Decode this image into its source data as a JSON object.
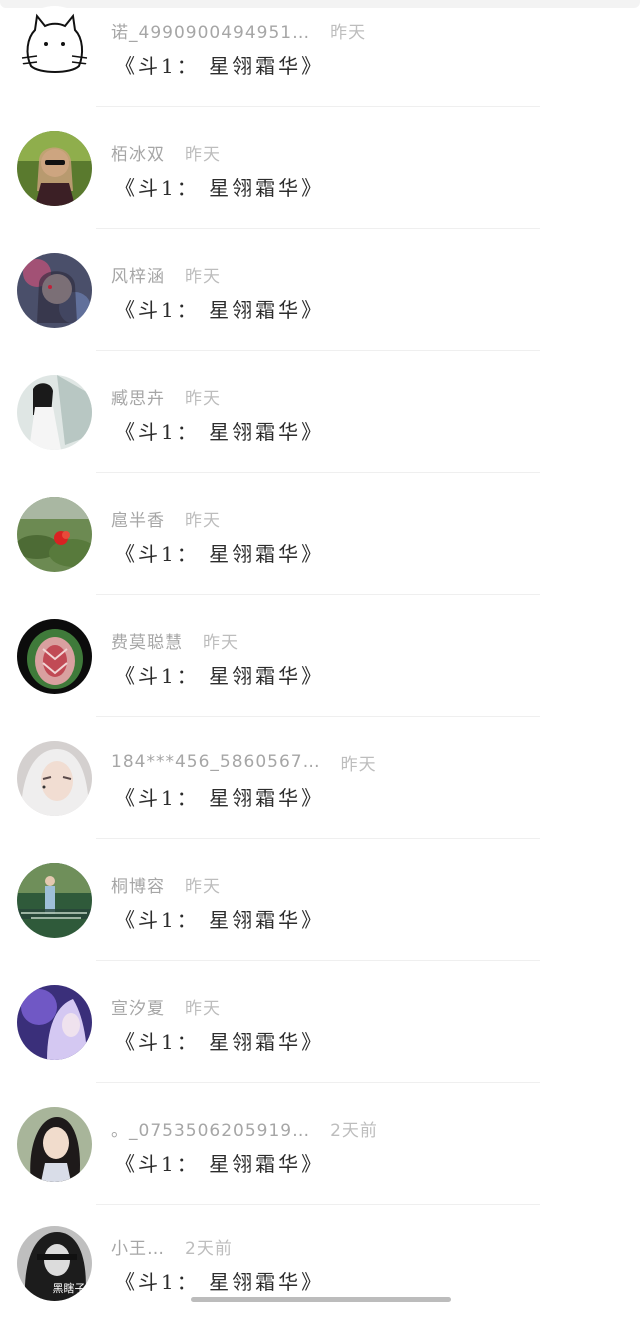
{
  "items": [
    {
      "name": "诺_4990900494951…",
      "time": "昨天",
      "title": "《斗1： 星翎霜华》",
      "avatar": "cat-sketch-avatar"
    },
    {
      "name": "栢冰双",
      "time": "昨天",
      "title": "《斗1： 星翎霜华》",
      "avatar": "girl-sunglasses-avatar"
    },
    {
      "name": "风梓涵",
      "time": "昨天",
      "title": "《斗1： 星翎霜华》",
      "avatar": "fantasy-girl-avatar"
    },
    {
      "name": "臧思卉",
      "time": "昨天",
      "title": "《斗1： 星翎霜华》",
      "avatar": "white-robe-man-avatar"
    },
    {
      "name": "扈半香",
      "time": "昨天",
      "title": "《斗1： 星翎霜华》",
      "avatar": "mossy-landscape-avatar"
    },
    {
      "name": "费莫聪慧",
      "time": "昨天",
      "title": "《斗1： 星翎霜华》",
      "avatar": "carved-fruit-avatar"
    },
    {
      "name": "184***456_5860567…",
      "time": "昨天",
      "title": "《斗1： 星翎霜华》",
      "avatar": "anime-white-hair-avatar"
    },
    {
      "name": "桐博容",
      "time": "昨天",
      "title": "《斗1： 星翎霜华》",
      "avatar": "stage-performer-avatar"
    },
    {
      "name": "宣汐夏",
      "time": "昨天",
      "title": "《斗1： 星翎霜华》",
      "avatar": "purple-anime-avatar"
    },
    {
      "name": "。_0753506205919…",
      "time": "2天前",
      "title": "《斗1： 星翎霜华》",
      "avatar": "girl-selfie-avatar"
    },
    {
      "name": "小王…",
      "time": "2天前",
      "title": "《斗1： 星翎霜华》",
      "avatar": "dark-anime-avatar",
      "avatar_caption": "黑瞎子"
    }
  ]
}
